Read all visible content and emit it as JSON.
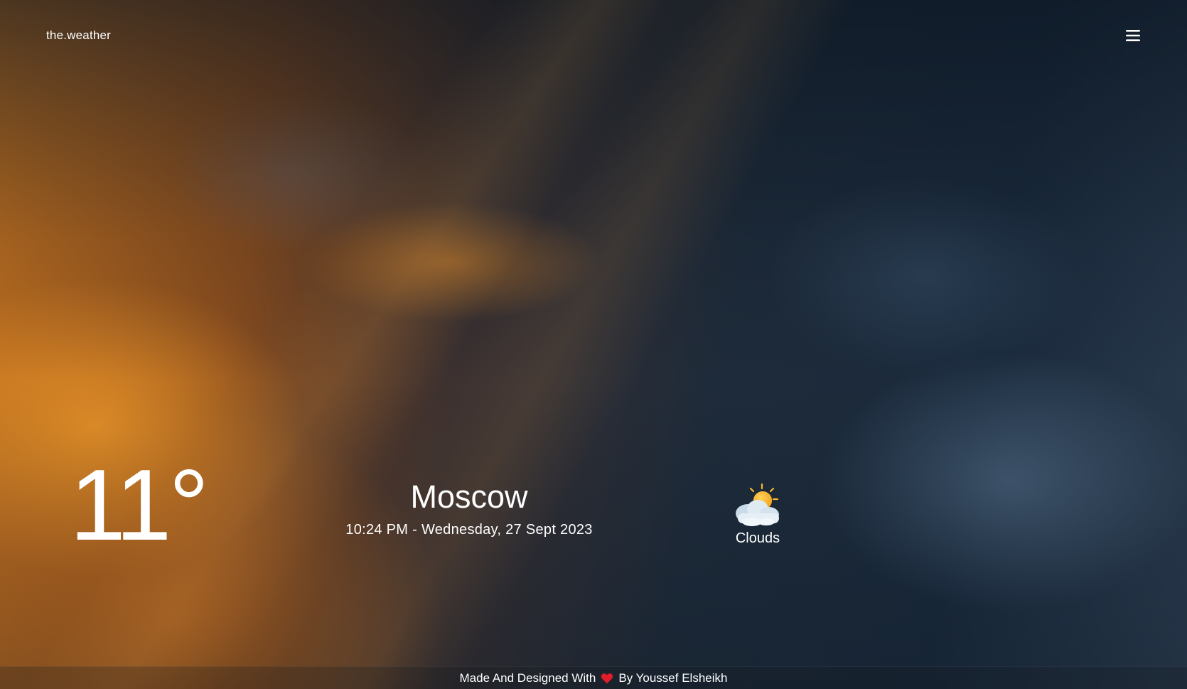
{
  "header": {
    "brand": "the.weather",
    "menu_icon": "hamburger-menu-icon"
  },
  "weather": {
    "temperature": "11°",
    "city": "Moscow",
    "datetime": "10:24 PM - Wednesday, 27 Sept 2023",
    "condition": "Clouds",
    "condition_icon": "partly-cloudy-icon"
  },
  "footer": {
    "prefix": "Made And Designed With",
    "heart_icon": "heart-icon",
    "heart_color": "#e11d2a",
    "suffix": "By Youssef Elsheikh"
  },
  "colors": {
    "text": "#ffffff",
    "sun": "#f9b92b",
    "cloud": "#dfeaf3"
  }
}
